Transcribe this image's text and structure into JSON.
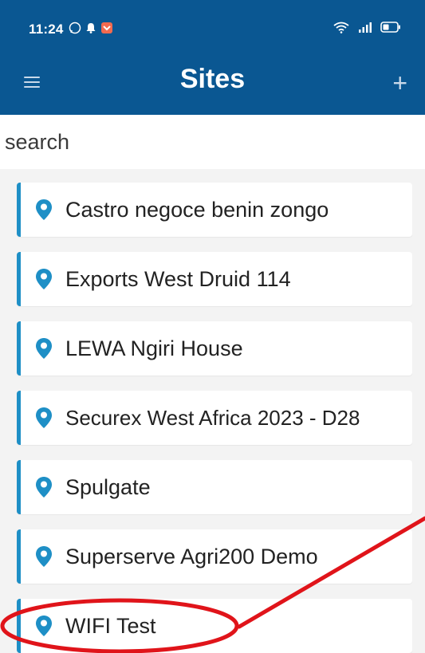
{
  "status_bar": {
    "time": "11:24",
    "icons_left": [
      "whatsapp-icon",
      "notification-bell-icon",
      "app-badge-icon"
    ],
    "icons_right": [
      "wifi-6-icon",
      "signal-icon",
      "battery-icon"
    ]
  },
  "app_bar": {
    "title": "Sites",
    "menu_icon": "hamburger-icon",
    "add_label": "+"
  },
  "search": {
    "placeholder": "search",
    "value": ""
  },
  "sites": [
    {
      "name": "Castro negoce benin zongo"
    },
    {
      "name": "Exports West Druid 114"
    },
    {
      "name": "LEWA Ngiri House"
    },
    {
      "name": "Securex West Africa 2023 - D28"
    },
    {
      "name": "Spulgate"
    },
    {
      "name": "Superserve Agri200 Demo"
    },
    {
      "name": "WIFI Test"
    }
  ],
  "colors": {
    "header": "#0a5792",
    "accent": "#1e8fc6",
    "annotation": "#e0141a",
    "background": "#f3f3f3"
  }
}
